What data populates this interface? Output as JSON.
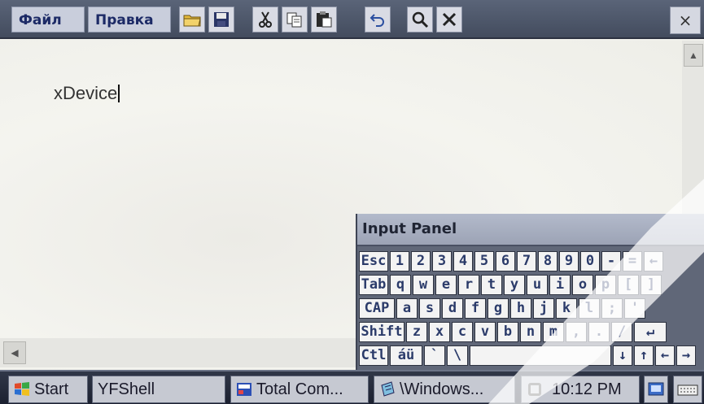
{
  "menubar": {
    "file_label": "Файл",
    "edit_label": "Правка",
    "toolbar_icons": [
      "open-folder-icon",
      "save-icon",
      "cut-icon",
      "copy-icon",
      "paste-icon",
      "undo-icon",
      "find-icon",
      "delete-icon"
    ],
    "close_label": "×"
  },
  "editor": {
    "text": "xDevice"
  },
  "input_panel": {
    "title": "Input Panel",
    "rows": [
      [
        "Esc",
        "1",
        "2",
        "3",
        "4",
        "5",
        "6",
        "7",
        "8",
        "9",
        "0",
        "-",
        "=",
        "←"
      ],
      [
        "Tab",
        "q",
        "w",
        "e",
        "r",
        "t",
        "y",
        "u",
        "i",
        "o",
        "p",
        "[",
        "]"
      ],
      [
        "CAP",
        "a",
        "s",
        "d",
        "f",
        "g",
        "h",
        "j",
        "k",
        "l",
        ";",
        "'"
      ],
      [
        "Shift",
        "z",
        "x",
        "c",
        "v",
        "b",
        "n",
        "m",
        ",",
        ".",
        "/",
        "↵"
      ],
      [
        "Ctl",
        "áü",
        "`",
        "\\",
        "",
        "↓",
        "↑",
        "←",
        "→"
      ]
    ]
  },
  "taskbar": {
    "start_label": "Start",
    "tasks": [
      "YFShell",
      "Total Com...",
      "\\Windows..."
    ],
    "clock": "10:12 PM"
  },
  "colors": {
    "menubar": "#4c5568",
    "background": "#f1f1ec",
    "key_text": "#2b3b6a"
  }
}
